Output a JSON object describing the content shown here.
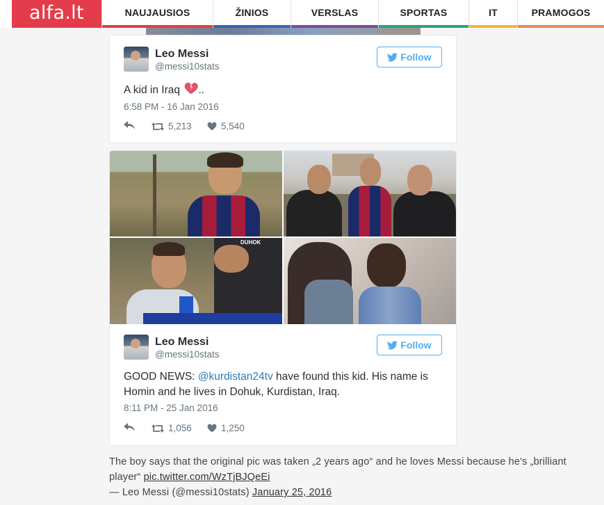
{
  "site": {
    "logo": "alfa.lt"
  },
  "nav": {
    "items": [
      {
        "label": "NAUJAUSIOS",
        "color": "#e43c4a"
      },
      {
        "label": "ŽINIOS",
        "color": "#3a63b0"
      },
      {
        "label": "VERSLAS",
        "color": "#7b4a9e"
      },
      {
        "label": "SPORTAS",
        "color": "#2aa37a"
      },
      {
        "label": "IT",
        "color": "#f2b632"
      },
      {
        "label": "PRAMOGOS",
        "color": "#e58a5a"
      }
    ]
  },
  "tweets": [
    {
      "author_name": "Leo Messi",
      "author_handle": "@messi10stats",
      "follow_label": "Follow",
      "text": "A kid in Iraq",
      "text_suffix": "..",
      "emoji_icon": "broken-heart-icon",
      "timestamp": "6:58 PM - 16 Jan 2016",
      "retweets": "5,213",
      "likes": "5,540"
    },
    {
      "author_name": "Leo Messi",
      "author_handle": "@messi10stats",
      "follow_label": "Follow",
      "text_prefix": "GOOD NEWS: ",
      "mention": "@kurdistan24tv",
      "text_rest": " have found this kid. His name is Homin and he lives in Dohuk, Kurdistan, Iraq.",
      "timestamp": "8:11 PM - 25 Jan 2016",
      "retweets": "1,056",
      "likes": "1,250",
      "media_overlay_text": "DUHOK"
    }
  ],
  "caption": {
    "text": "The boy says that the original pic was taken „2 years ago“ and he loves Messi because he's „brilliant player“ ",
    "link": "pic.twitter.com/WzTjBJQeEi",
    "attribution": "— Leo Messi (@messi10stats) ",
    "date_link": "January 25, 2016"
  },
  "colors": {
    "accent": "#55acee",
    "mention": "#2b7bb9",
    "logo_bg": "#e43c4a"
  }
}
